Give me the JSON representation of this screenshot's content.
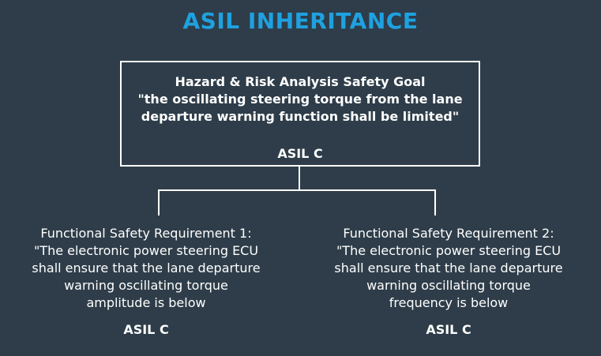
{
  "title": "ASIL INHERITANCE",
  "safety_goal": {
    "heading": "Hazard & Risk Analysis Safety Goal",
    "line1": "\"the oscillating steering torque from the lane",
    "line2": "departure warning function shall be limited\"",
    "asil": "ASIL C"
  },
  "requirements": [
    {
      "line1": "Functional Safety Requirement 1:",
      "line2": "\"The electronic power steering ECU",
      "line3": "shall ensure that the lane departure",
      "line4": "warning oscillating torque",
      "line5": "amplitude is below",
      "asil": "ASIL C"
    },
    {
      "line1": "Functional Safety Requirement 2:",
      "line2": "\"The electronic power steering ECU",
      "line3": "shall ensure that the lane departure",
      "line4": "warning oscillating torque",
      "line5": "frequency is below",
      "asil": "ASIL C"
    }
  ],
  "colors": {
    "background": "#2e3d49",
    "title": "#1fa1e0",
    "text": "#ffffff"
  }
}
